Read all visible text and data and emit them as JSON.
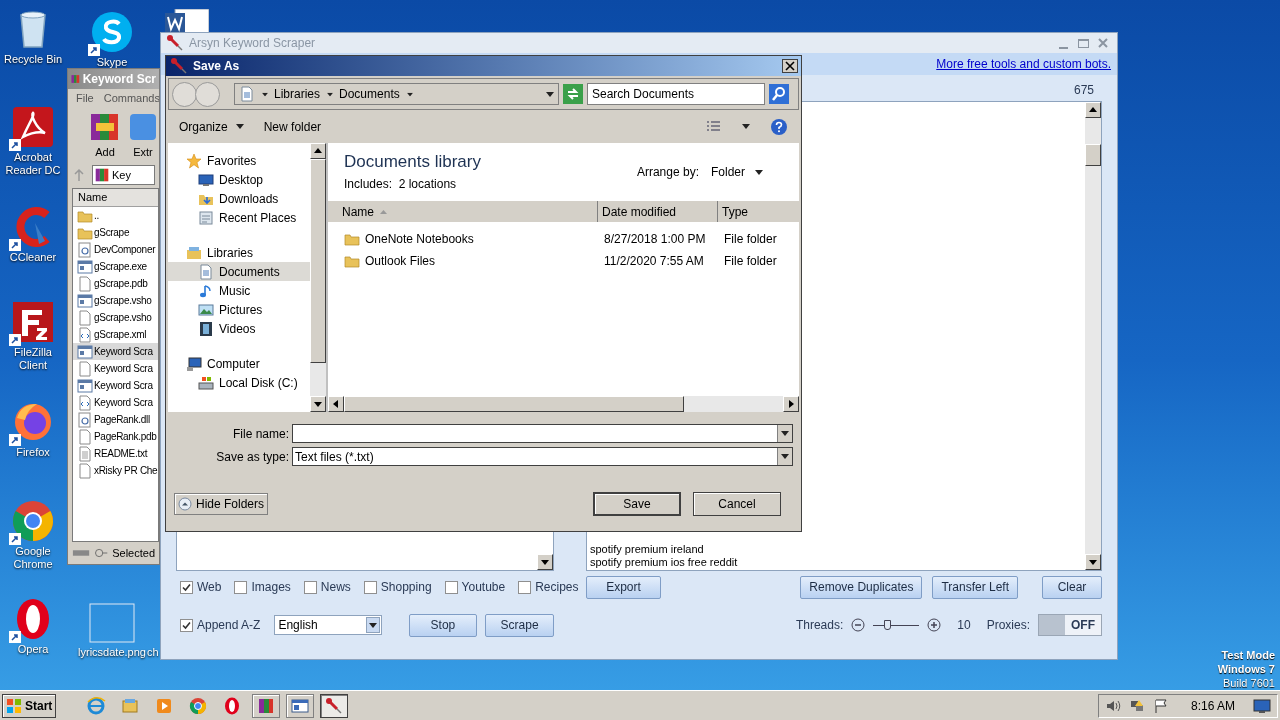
{
  "desktop_icons": [
    {
      "label": "Recycle Bin",
      "kind": "recycle"
    },
    {
      "label": "Acrobat Reader DC",
      "kind": "acrobat"
    },
    {
      "label": "CCleaner",
      "kind": "ccleaner"
    },
    {
      "label": "FileZilla Client",
      "kind": "filezilla"
    },
    {
      "label": "Firefox",
      "kind": "firefox"
    },
    {
      "label": "Google Chrome",
      "kind": "chrome"
    },
    {
      "label": "Opera",
      "kind": "opera"
    }
  ],
  "desktop_icons_2": [
    {
      "label": "Skype",
      "kind": "skype"
    },
    {
      "label": "lyricsdate.png",
      "kind": "image"
    }
  ],
  "desktop_fragment": "ch",
  "winrar": {
    "title": "Keyword Scr",
    "menu": [
      "File",
      "Commands"
    ],
    "toolbar": [
      {
        "label": "Add",
        "kind": "add"
      },
      {
        "label": "Extr",
        "kind": "extract"
      }
    ],
    "address": "Key",
    "column": "Name",
    "files": [
      {
        "name": "..",
        "kind": "folder",
        "selected": false
      },
      {
        "name": "gScrape",
        "kind": "folder",
        "selected": false
      },
      {
        "name": "DevComponer",
        "kind": "dll",
        "selected": false
      },
      {
        "name": "gScrape.exe",
        "kind": "exe",
        "selected": false
      },
      {
        "name": "gScrape.pdb",
        "kind": "file",
        "selected": false
      },
      {
        "name": "gScrape.vsho",
        "kind": "exe",
        "selected": false
      },
      {
        "name": "gScrape.vsho",
        "kind": "file",
        "selected": false
      },
      {
        "name": "gScrape.xml",
        "kind": "xml",
        "selected": false
      },
      {
        "name": "Keyword Scra",
        "kind": "exe",
        "selected": true
      },
      {
        "name": "Keyword Scra",
        "kind": "file",
        "selected": false
      },
      {
        "name": "Keyword Scra",
        "kind": "exe",
        "selected": false
      },
      {
        "name": "Keyword Scra",
        "kind": "xml",
        "selected": false
      },
      {
        "name": "PageRank.dll",
        "kind": "dll",
        "selected": false
      },
      {
        "name": "PageRank.pdb",
        "kind": "file",
        "selected": false
      },
      {
        "name": "README.txt",
        "kind": "text",
        "selected": false
      },
      {
        "name": "xRisky PR Che",
        "kind": "file",
        "selected": false
      }
    ],
    "status": "Selected"
  },
  "arsyn": {
    "title": "Arsyn Keyword Scraper",
    "link": "More free tools and custom bots.",
    "count": "675",
    "results": [
      "spotify premium ireland",
      "spotify premium ios free reddit"
    ],
    "engines": [
      {
        "label": "Web",
        "checked": true
      },
      {
        "label": "Images",
        "checked": false
      },
      {
        "label": "News",
        "checked": false
      },
      {
        "label": "Shopping",
        "checked": false
      },
      {
        "label": "Youtube",
        "checked": false
      },
      {
        "label": "Recipes",
        "checked": false
      }
    ],
    "append": {
      "label": "Append A-Z",
      "checked": true
    },
    "language": "English",
    "buttons_left": [
      "Stop",
      "Scrape"
    ],
    "buttons_right": [
      "Export",
      "Remove Duplicates",
      "Transfer Left",
      "Clear"
    ],
    "threads": {
      "label": "Threads:",
      "level": 0.3,
      "value": "10"
    },
    "proxies": {
      "label": "Proxies:",
      "on": false,
      "text": "OFF"
    }
  },
  "save_as": {
    "title": "Save As",
    "breadcrumb": [
      "Libraries",
      "Documents"
    ],
    "search": {
      "placeholder": "Search Documents"
    },
    "toolbar": [
      "Organize",
      "New folder"
    ],
    "nav": [
      {
        "label": "Favorites",
        "kind": "star",
        "selected": false,
        "children": [
          {
            "label": "Desktop",
            "kind": "desktop",
            "selected": false
          },
          {
            "label": "Downloads",
            "kind": "downloads",
            "selected": false
          },
          {
            "label": "Recent Places",
            "kind": "recent",
            "selected": false
          }
        ]
      },
      {
        "label": "Libraries",
        "kind": "library",
        "selected": false,
        "children": [
          {
            "label": "Documents",
            "kind": "documents",
            "selected": true
          },
          {
            "label": "Music",
            "kind": "music",
            "selected": false
          },
          {
            "label": "Pictures",
            "kind": "pictures",
            "selected": false
          },
          {
            "label": "Videos",
            "kind": "videos",
            "selected": false
          }
        ]
      },
      {
        "label": "Computer",
        "kind": "computer",
        "selected": false,
        "children": [
          {
            "label": "Local Disk (C:)",
            "kind": "disk",
            "selected": false
          }
        ]
      }
    ],
    "library_title": "Documents library",
    "includes": "Includes:  2 locations",
    "arrange_label": "Arrange by:",
    "arrange_value": "Folder",
    "columns": [
      "Name",
      "Date modified",
      "Type"
    ],
    "rows": [
      {
        "name": "OneNote Notebooks",
        "date": "8/27/2018 1:00 PM",
        "type": "File folder"
      },
      {
        "name": "Outlook Files",
        "date": "11/2/2020 7:55 AM",
        "type": "File folder"
      }
    ],
    "file_name_label": "File name:",
    "type_label": "Save as type:",
    "type_value": "Text files (*.txt)",
    "hide_folders": "Hide Folders",
    "buttons": [
      "Save",
      "Cancel"
    ]
  },
  "taskbar": {
    "start": "Start",
    "apps": [
      {
        "kind": "ie",
        "active": false
      },
      {
        "kind": "explorer",
        "active": false
      },
      {
        "kind": "media",
        "active": false
      },
      {
        "kind": "chrome",
        "active": false
      },
      {
        "kind": "opera",
        "active": false
      },
      {
        "kind": "winrar",
        "active": false
      },
      {
        "kind": "window",
        "active": false
      },
      {
        "kind": "arsyn",
        "active": true
      }
    ],
    "clock": "8:16 AM"
  },
  "os_notice": [
    "Test Mode",
    "Windows 7",
    "Build 7601"
  ]
}
